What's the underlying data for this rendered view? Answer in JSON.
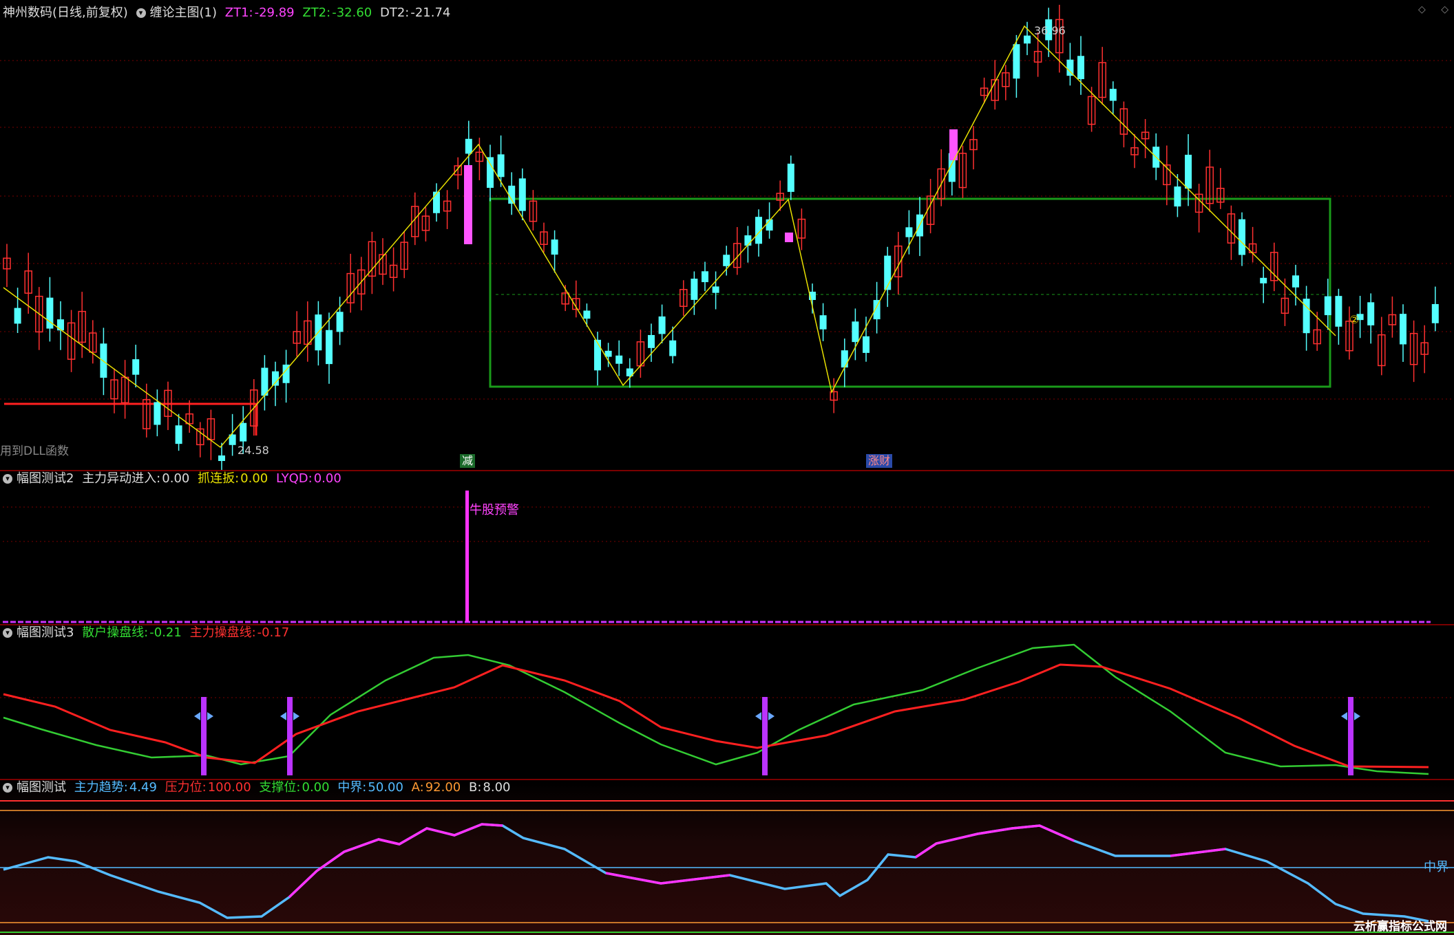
{
  "main": {
    "stock": "神州数码(日线,前复权)",
    "indicator": "缠论主图(1)",
    "zt1_label": "ZT1:",
    "zt1": "-29.89",
    "zt2_label": "ZT2:",
    "zt2": "-32.60",
    "dt2_label": "DT2:",
    "dt2": "-21.74",
    "high_label": "36.96",
    "low_label": "24.58",
    "dll_note": "用到DLL函数",
    "badge1": "减",
    "badge2": "涨财",
    "marker": "②"
  },
  "p2": {
    "title": "幅图测试2",
    "k1": "主力异动进入:",
    "v1": "0.00",
    "k2": "抓连扳:",
    "v2": "0.00",
    "k3": "LYQD:",
    "v3": "0.00",
    "alert": "牛股预警"
  },
  "p3": {
    "title": "幅图测试3",
    "k1": "散户操盘线:",
    "v1": "-0.21",
    "k2": "主力操盘线:",
    "v2": "-0.17"
  },
  "p4": {
    "title": "幅图测试",
    "k1": "主力趋势:",
    "v1": "4.49",
    "k2": "压力位:",
    "v2": "100.00",
    "k3": "支撑位:",
    "v3": "0.00",
    "k4": "中界:",
    "v4": "50.00",
    "k5": "A:",
    "v5": "92.00",
    "k6": "B:",
    "v6": "8.00",
    "mid_label": "中界"
  },
  "watermark": "云析赢指标公式网",
  "colors": {
    "up": "#ff3030",
    "down": "#54ffff",
    "zigzag": "#e8e000",
    "box": "#1a9a1a",
    "magenta": "#ff33ff",
    "green": "#33cc33",
    "red": "#ff2020",
    "blue": "#55bbff"
  }
}
